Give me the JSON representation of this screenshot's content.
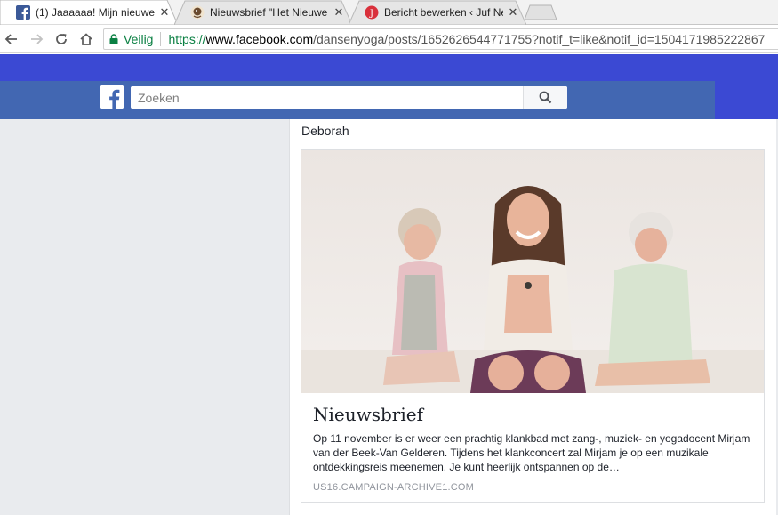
{
  "browser": {
    "tabs": [
      {
        "title": "(1) Jaaaaaa! Mijn nieuwe",
        "icon": "facebook-icon",
        "active": true
      },
      {
        "title": "Nieuwsbrief \"Het Nieuwe",
        "icon": "mailchimp-icon",
        "active": false
      },
      {
        "title": "Bericht bewerken ‹ Juf Ne",
        "icon": "j-logo-icon",
        "active": false
      }
    ],
    "close_glyph": "✕",
    "security_label": "Veilig",
    "url": {
      "scheme": "https://",
      "host": "www.facebook.com",
      "path": "/dansenyoga/posts/1652626544771755?notif_t=like&notif_id=1504171985222867"
    }
  },
  "facebook": {
    "search_placeholder": "Zoeken",
    "brand_color": "#4267b2"
  },
  "post": {
    "author": "Deborah",
    "link_card": {
      "title": "Nieuwsbrief",
      "description": "Op 11 november is er weer een prachtig klankbad met zang-, muziek- en yogadocent Mirjam van der Beek-Van Gelderen. Tijdens het klankconcert zal Mirjam je op een muzikale ontdekkingsreis meenemen. Je kunt heerlijk ontspannen op de…",
      "domain": "US16.CAMPAIGN-ARCHIVE1.COM"
    }
  }
}
